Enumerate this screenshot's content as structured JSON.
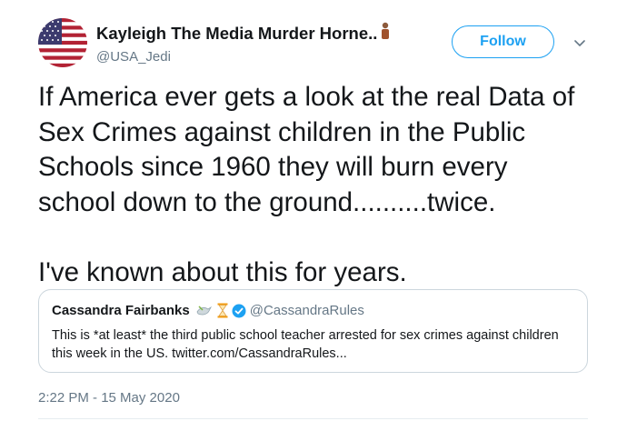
{
  "author": {
    "display_name": "Kayleigh The Media Murder Horne..",
    "handle": "@USA_Jedi",
    "avatar_icon": "us-flag-avatar",
    "name_emoji": "person-emoji"
  },
  "actions": {
    "follow_label": "Follow",
    "more_icon": "chevron-down-icon"
  },
  "tweet": {
    "text": "If America ever gets a look at the real Data of\nSex Crimes against children in the Public\nSchools since 1960 they will burn every\nschool down to the ground..........twice.\n\nI've known about this for years.",
    "timestamp": "2:22 PM - 15 May 2020"
  },
  "quoted_tweet": {
    "display_name": "Cassandra Fairbanks",
    "emojis": [
      "dove-icon",
      "hourglass-icon"
    ],
    "verified_icon": "verified-badge-icon",
    "handle": "@CassandraRules",
    "text": "This is *at least* the third public school teacher arrested for sex crimes against children this week in the US. twitter.com/CassandraRules..."
  },
  "colors": {
    "accent": "#1da1f2",
    "text_primary": "#14171a",
    "text_secondary": "#657786",
    "border": "#ccd6dd"
  }
}
